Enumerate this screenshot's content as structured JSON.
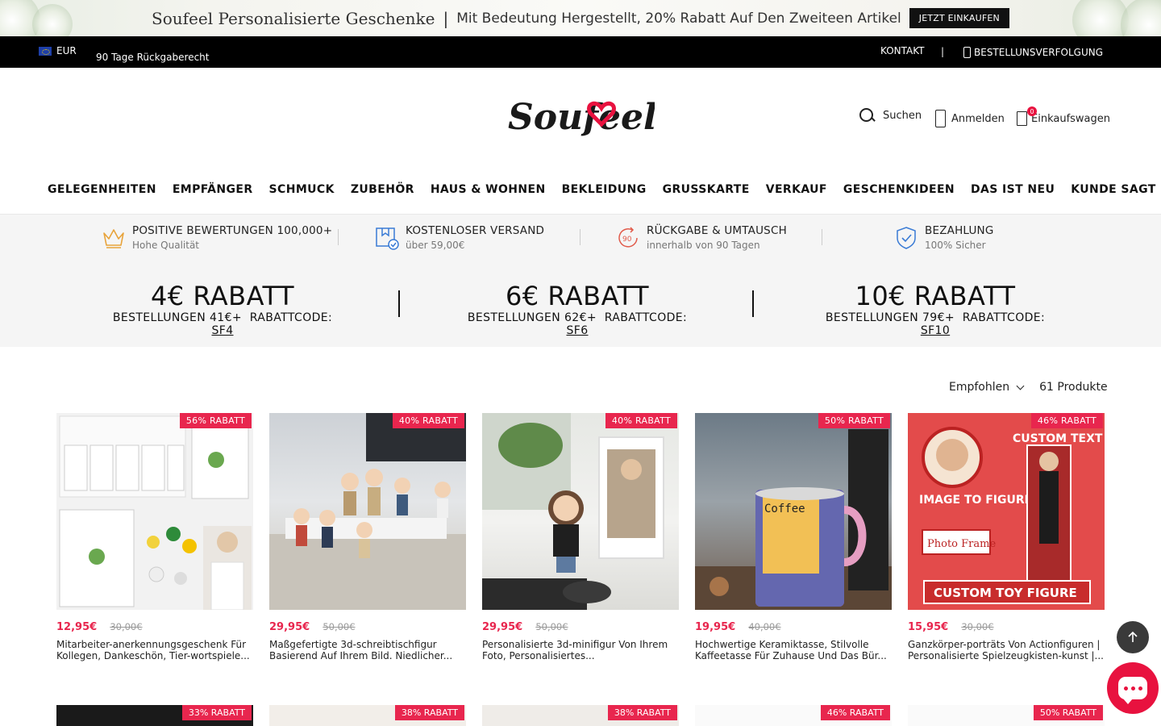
{
  "banner": {
    "brand": "Soufeel Personalisierte Geschenke",
    "separator": "|",
    "promo": "Mit Bedeutung Hergestellt, 20% Rabatt Auf Den Zweiteen Artikel",
    "button": "JETZT EINKAUFEN"
  },
  "topbar": {
    "currency": "EUR",
    "returns": "90 Tage Rückgaberecht",
    "contact": "KONTAKT",
    "separator": "|",
    "tracking": "BESTELLUNSVERFOLGUNG"
  },
  "header": {
    "logo": "Soufeel",
    "search": "Suchen",
    "login": "Anmelden",
    "cart": "Einkaufswagen",
    "cart_count": "0"
  },
  "nav": [
    "GELEGENHEITEN",
    "EMPFÄNGER",
    "SCHMUCK",
    "ZUBEHÖR",
    "HAUS & WOHNEN",
    "BEKLEIDUNG",
    "GRUSSKARTE",
    "VERKAUF",
    "GESCHENKIDEEN",
    "DAS IST NEU",
    "KUNDE SAGT"
  ],
  "benefits": [
    {
      "icon": "crown-icon",
      "title": "POSITIVE BEWERTUNGEN 100,000+",
      "sub": "Hohe Qualität"
    },
    {
      "icon": "shipping-box-icon",
      "title": "KOSTENLOSER VERSAND",
      "sub": "über 59,00€"
    },
    {
      "icon": "return-90-icon",
      "title": "RÜCKGABE & UMTAUSCH",
      "sub": "innerhalb von 90 Tagen"
    },
    {
      "icon": "shield-check-icon",
      "title": "BEZAHLUNG",
      "sub": "100% Sicher"
    }
  ],
  "coupons": [
    {
      "amount": "4€ RABATT",
      "condition": "BESTELLUNGEN 41€+",
      "code_label": "RABATTCODE:",
      "code": "SF4"
    },
    {
      "amount": "6€ RABATT",
      "condition": "BESTELLUNGEN 62€+",
      "code_label": "RABATTCODE:",
      "code": "SF6"
    },
    {
      "amount": "10€ RABATT",
      "condition": "BESTELLUNGEN 79€+",
      "code_label": "RABATTCODE:",
      "code": "SF10"
    }
  ],
  "listing": {
    "sort": "Empfohlen",
    "count": "61 Produkte"
  },
  "products": [
    {
      "badge": "56% RABATT",
      "price": "12,95€",
      "old_price": "30,00€",
      "title": "Mitarbeiter-anerkennungsgeschenk Für Kollegen, Dankeschön, Tier-wortspiele..."
    },
    {
      "badge": "40% RABATT",
      "price": "29,95€",
      "old_price": "50,00€",
      "title": "Maßgefertigte 3d-schreibtischfigur Basierend Auf Ihrem Bild. Niedlicher..."
    },
    {
      "badge": "40% RABATT",
      "price": "29,95€",
      "old_price": "50,00€",
      "title": "Personalisierte 3d-minifigur Von Ihrem Foto, Personalisiertes..."
    },
    {
      "badge": "50% RABATT",
      "price": "19,95€",
      "old_price": "40,00€",
      "title": "Hochwertige Keramiktasse, Stilvolle Kaffeetasse Für Zuhause Und Das Bür..."
    },
    {
      "badge": "46% RABATT",
      "price": "15,95€",
      "old_price": "30,00€",
      "title": "Ganzkörper-porträts Von Actionfiguren | Personalisierte Spielzeugkisten-kunst |..."
    }
  ],
  "product_texts": {
    "mug_label": "Coffee",
    "figure_top": "CUSTOM TEXT",
    "figure_left": "IMAGE TO FIGURE",
    "figure_frame": "Photo Frame",
    "figure_bottom": "CUSTOM TOY FIGURE"
  },
  "products_row2_badges": [
    "33% RABATT",
    "38% RABATT",
    "38% RABATT",
    "46% RABATT",
    "50% RABATT"
  ],
  "colors": {
    "accent": "#e8264e",
    "topbar": "#000000",
    "benefits_bg": "#f5f5f5"
  }
}
